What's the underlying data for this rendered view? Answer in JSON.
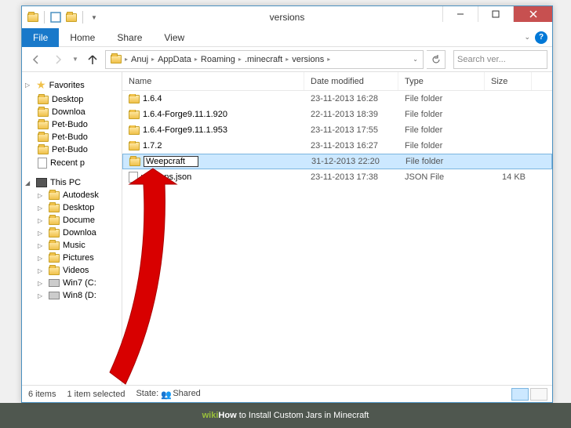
{
  "window_title": "versions",
  "tabs": {
    "file": "File",
    "home": "Home",
    "share": "Share",
    "view": "View"
  },
  "breadcrumb": [
    "Anuj",
    "AppData",
    "Roaming",
    ".minecraft",
    "versions"
  ],
  "search_placeholder": "Search ver...",
  "columns": {
    "name": "Name",
    "date": "Date modified",
    "type": "Type",
    "size": "Size"
  },
  "favorites": {
    "header": "Favorites",
    "items": [
      "Desktop",
      "Downloa",
      "Pet-Budo",
      "Pet-Budo",
      "Pet-Budo",
      "Recent p"
    ]
  },
  "this_pc": {
    "header": "This PC",
    "items": [
      "Autodesk",
      "Desktop",
      "Docume",
      "Downloa",
      "Music",
      "Pictures",
      "Videos",
      "Win7 (C:",
      "Win8 (D:"
    ]
  },
  "files": [
    {
      "name": "1.6.4",
      "date": "23-11-2013 16:28",
      "type": "File folder",
      "size": "",
      "icon": "folder"
    },
    {
      "name": "1.6.4-Forge9.11.1.920",
      "date": "22-11-2013 18:39",
      "type": "File folder",
      "size": "",
      "icon": "folder"
    },
    {
      "name": "1.6.4-Forge9.11.1.953",
      "date": "23-11-2013 17:55",
      "type": "File folder",
      "size": "",
      "icon": "folder"
    },
    {
      "name": "1.7.2",
      "date": "23-11-2013 16:27",
      "type": "File folder",
      "size": "",
      "icon": "folder"
    },
    {
      "name": "Weepcraft",
      "date": "31-12-2013 22:20",
      "type": "File folder",
      "size": "",
      "icon": "folder",
      "selected": true,
      "renaming": true
    },
    {
      "name": "versions.json",
      "date": "23-11-2013 17:38",
      "type": "JSON File",
      "size": "14 KB",
      "icon": "json"
    }
  ],
  "status": {
    "items": "6 items",
    "selected": "1 item selected",
    "state_label": "State:",
    "state_value": "Shared"
  },
  "caption": {
    "wiki": "wiki",
    "how": "How",
    "rest": " to Install Custom Jars in Minecraft"
  }
}
